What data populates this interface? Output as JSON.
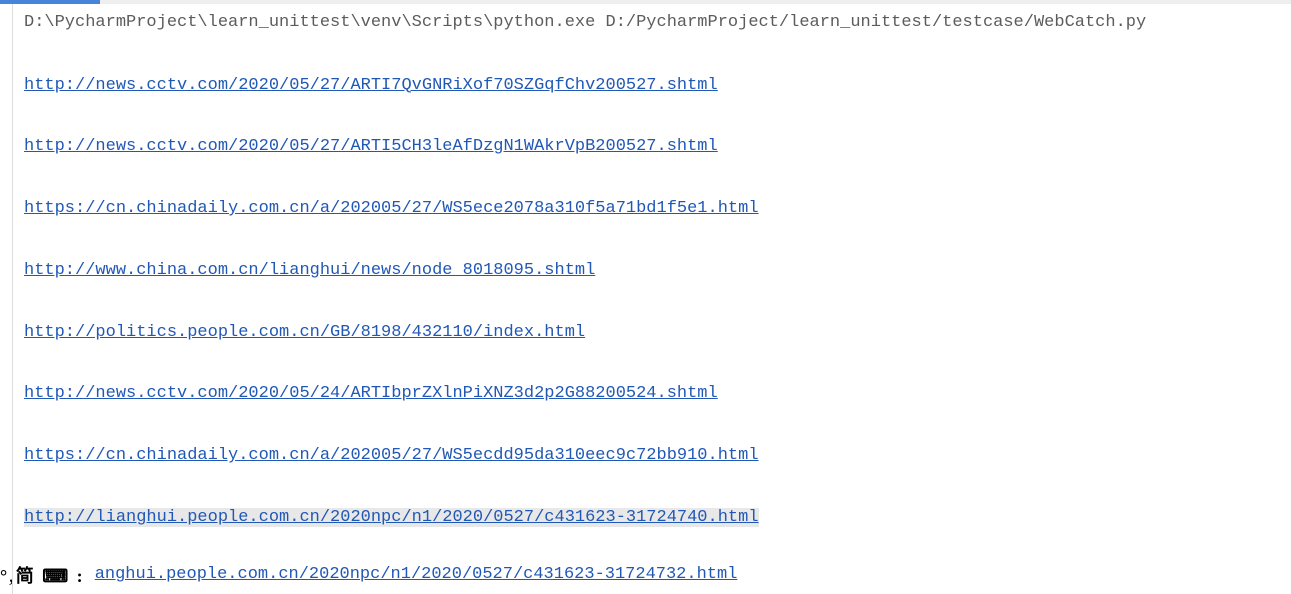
{
  "command_line": "D:\\PycharmProject\\learn_unittest\\venv\\Scripts\\python.exe D:/PycharmProject/learn_unittest/testcase/WebCatch.py",
  "urls": [
    {
      "text": "http://news.cctv.com/2020/05/27/ARTI7QvGNRiXof70SZGqfChv200527.shtml",
      "highlighted": false
    },
    {
      "text": "http://news.cctv.com/2020/05/27/ARTI5CH3leAfDzgN1WAkrVpB200527.shtml",
      "highlighted": false
    },
    {
      "text": "https://cn.chinadaily.com.cn/a/202005/27/WS5ece2078a310f5a71bd1f5e1.html",
      "highlighted": false
    },
    {
      "text": "http://www.china.com.cn/lianghui/news/node_8018095.shtml",
      "highlighted": false
    },
    {
      "text": "http://politics.people.com.cn/GB/8198/432110/index.html",
      "highlighted": false
    },
    {
      "text": "http://news.cctv.com/2020/05/24/ARTIbprZXlnPiXNZ3d2p2G88200524.shtml",
      "highlighted": false
    },
    {
      "text": "https://cn.chinadaily.com.cn/a/202005/27/WS5ecdd95da310eec9c72bb910.html",
      "highlighted": false
    },
    {
      "text": "http://lianghui.people.com.cn/2020npc/n1/2020/0527/c431623-31724740.html",
      "highlighted": true
    }
  ],
  "ime_label": "°,简 ⌨ :",
  "partial_url": "anghui.people.com.cn/2020npc/n1/2020/0527/c431623-31724732.html"
}
